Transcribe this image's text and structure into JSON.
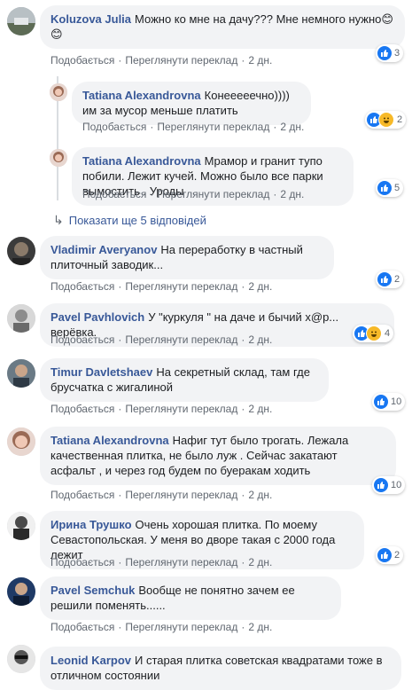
{
  "labels": {
    "like": "Подобається",
    "translate": "Переглянути переклад",
    "show_more_replies": "Показати ще 5 відповідей"
  },
  "comments": [
    {
      "author": "Koluzova Julia",
      "text": "Можно ко мне на дачу??? Мне немного нужно😊 😊",
      "time": "2 дн.",
      "reaction_count": "3",
      "reactions": [
        "like"
      ]
    },
    {
      "author": "Tatiana Alexandrovna",
      "text": "Конееееечно)))) им за мусор меньше платить",
      "time": "2 дн.",
      "reaction_count": "2",
      "reactions": [
        "like",
        "haha"
      ]
    },
    {
      "author": "Tatiana Alexandrovna",
      "text": "Мрамор и гранит тупо побили. Лежит кучей. Можно было все парки вымостить . Уроды",
      "time": "2 дн.",
      "reaction_count": "5",
      "reactions": [
        "like"
      ]
    },
    {
      "author": "Vladimir Averyanov",
      "text": "На переработку в частный плиточный заводик...",
      "time": "2 дн.",
      "reaction_count": "2",
      "reactions": [
        "like"
      ]
    },
    {
      "author": "Pavel Pavhlovich",
      "text": "У \"куркуля \" на даче и бычий х@р... верёвка.",
      "time": "2 дн.",
      "reaction_count": "4",
      "reactions": [
        "like",
        "haha"
      ]
    },
    {
      "author": "Timur Davletshaev",
      "text": "На секретный склад, там где брусчатка с жигалиной",
      "time": "2 дн.",
      "reaction_count": "10",
      "reactions": [
        "like"
      ]
    },
    {
      "author": "Tatiana Alexandrovna",
      "text": "Нафиг тут было трогать. Лежала качественная плитка, не было луж . Сейчас закатают асфальт , и через год будем по буеракам ходить",
      "time": "2 дн.",
      "reaction_count": "10",
      "reactions": [
        "like"
      ]
    },
    {
      "author": "Ирина Трушко",
      "text": "Очень хорошая плитка. По моему Севастопольская. У меня во дворе такая с 2000 года лежит",
      "time": "2 дн.",
      "reaction_count": "2",
      "reactions": [
        "like"
      ]
    },
    {
      "author": "Pavel Semchuk",
      "text": "Вообще не понятно зачем ее решили поменять......",
      "time": "2 дн.",
      "reaction_count": "",
      "reactions": []
    },
    {
      "author": "Leonid Karpov",
      "text": "И старая плитка советская квадратами тоже в отличном состоянии",
      "time": "",
      "reaction_count": "",
      "reactions": []
    }
  ]
}
